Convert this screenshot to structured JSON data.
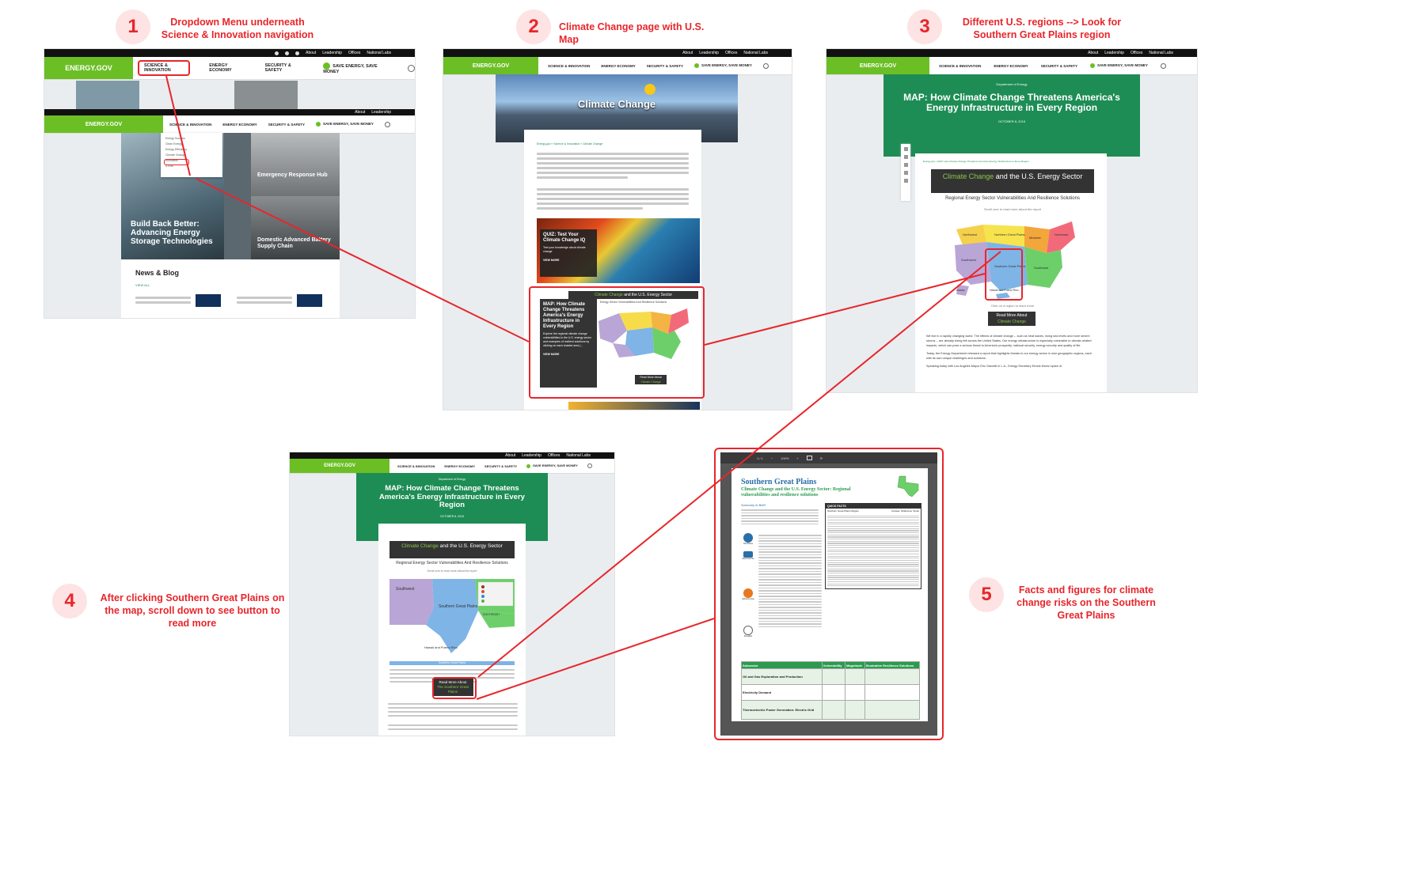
{
  "steps": [
    {
      "number": "1",
      "caption": "Dropdown Menu underneath Science & Innovation navigation"
    },
    {
      "number": "2",
      "caption": "Climate Change page with U.S. Map"
    },
    {
      "number": "3",
      "caption": "Different U.S. regions --> Look for Southern Great Plains region"
    },
    {
      "number": "4",
      "caption": "After clicking Southern Great Plains on the map, scroll down to see button to read more"
    },
    {
      "number": "5",
      "caption": "Facts and figures for climate change risks on the Southern Great Plains"
    }
  ],
  "site": {
    "logo": "ENERGY.GOV",
    "nav": [
      "SCIENCE & INNOVATION",
      "ENERGY ECONOMY",
      "SECURITY & SAFETY",
      "SAVE ENERGY, SAVE MONEY"
    ],
    "util_links": [
      "About",
      "Leadership",
      "Offices",
      "National Labs"
    ]
  },
  "shot1": {
    "tile_storage": "Build Back Better: Advancing Energy Storage Technologies",
    "tile_emergency": "Emergency Response Hub",
    "tile_battery": "Domestic Advanced Battery Supply Chain",
    "news_heading": "News & Blog",
    "view_all": "VIEW ALL",
    "dropdown": [
      "Energy Sources",
      "Clean Energy",
      "Energy Efficiency",
      "Climate Change",
      "Innovation",
      "STEM"
    ]
  },
  "shot2": {
    "hero_title": "Climate Change",
    "breadcrumb": "Energy.gov » Science & Innovation » Climate Change",
    "quiz_title": "QUIZ: Test Your Climate Change IQ",
    "quiz_body": "Test your knowledge about climate change",
    "view_more": "VIEW MORE",
    "map_tile_title": "MAP: How Climate Change Threatens America's Energy Infrastructure in Every Region",
    "map_tile_body": "Explore the regional climate change vulnerabilities to the U.S. energy sector and examples of resilient solutions by clicking on each shaded area (...",
    "map_header_a": "Climate Change",
    "map_header_b": "and the U.S. Energy Sector",
    "map_sub": "Energy Sector Vulnerabilities And Resilience Solutions",
    "read_more_a": "Read More About",
    "read_more_b": "Climate Change"
  },
  "shot3": {
    "dept": "Department of Energy",
    "title": "MAP: How Climate Change Threatens America's Energy Infrastructure in Every Region",
    "date": "OCTOBER 8, 2015",
    "breadcrumb": "Energy.gov » MAP: How Climate Change Threatens America's Energy Infrastructure in Every Region",
    "map_header_a": "Climate Change",
    "map_header_b": "and the U.S. Energy Sector",
    "map_sub": "Regional Energy Sector Vulnerabilities And Resilience Solutions",
    "scroll_hint": "Scroll over to read more about the report",
    "click_hint": "Click on a region to learn more",
    "read_more_a": "Read More About",
    "read_more_b": "Climate Change",
    "region_labels": [
      "Northwest",
      "Northern Great Plains",
      "Midwest",
      "Northeast",
      "Southwest",
      "Southern Great Plains",
      "Southeast",
      "Alaska",
      "Hawaii and Puerto Rico"
    ],
    "para1": "We live in a rapidly changing world. The effects of climate change -- such as heat waves, rising sea levels and more severe storms -- are already being felt across the United States. Our energy infrastructure is especially vulnerable to climate-related impacts, which can pose a serious threat to America's prosperity, national security, energy security and quality of life.",
    "para2": "Today, the Energy Department released a report that highlights threats to our energy sector in nine geographic regions, each with its own unique challenges and solutions.",
    "para3": "Speaking today with Los Angeles Mayor Eric Garcetti in L.A., Energy Secretary Ernest Moniz spoke of"
  },
  "shot4": {
    "dept": "Department of Energy",
    "title": "MAP: How Climate Change Threatens America's Energy Infrastructure in Every Region",
    "date": "OCTOBER 8, 2015",
    "map_header_a": "Climate Change",
    "map_header_b": "and the U.S. Energy Sector",
    "map_sub": "Regional Energy Sector Vulnerabilities And Resilience Solutions",
    "scroll_hint": "Scroll over to read more about the report",
    "label_southwest": "Southwest",
    "label_sgp": "Southern Great Plains",
    "label_hawaii": "Hawaii and Puerto Rico",
    "label_southeast": "SOUTHEAST",
    "sgp_bar": "Southern Great Plains",
    "read_more_a": "Read More About",
    "read_more_b": "The Southern Great Plains"
  },
  "shot5": {
    "toolbar_page": "1 / 1",
    "toolbar_zoom": "100%",
    "pdf_title": "Southern Great Plains",
    "pdf_subtitle": "Climate Change and the U.S. Energy Sector: Regional vulnerabilities and resilience solutions",
    "summary": "Summary in Brief",
    "quick_facts": "QUICK FACTS",
    "quick_facts_region": "Southern Great Plains Region",
    "quick_facts_states": "Kansas, Oklahoma, Texas",
    "table_cols": [
      "Subsector",
      "Vulnerability",
      "Magnitude",
      "Illustrative Resilience Solutions"
    ],
    "table_rows": [
      "Oil and Gas Exploration and Production",
      "Electricity Demand",
      "Thermoelectric Power Generation: Electric Grid"
    ],
    "icon_labels": [
      "Hurricanes",
      "Sea level rise",
      "Extreme heat",
      "Droughts"
    ]
  }
}
